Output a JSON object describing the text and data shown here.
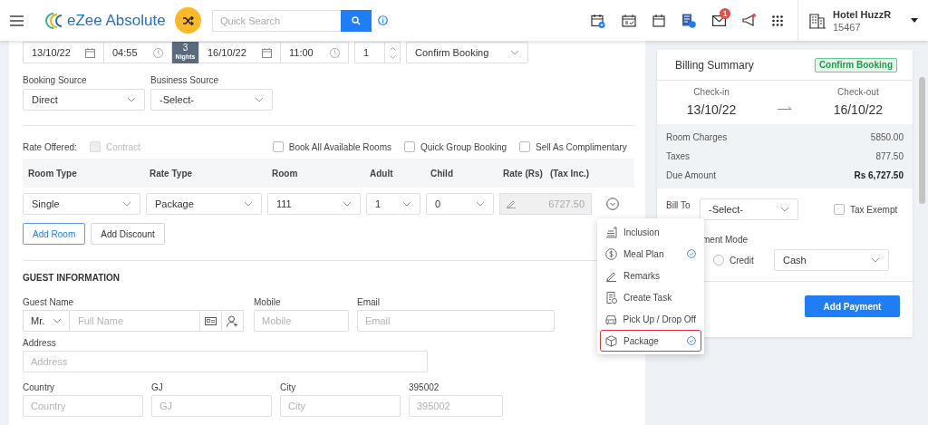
{
  "header": {
    "logo": "eZee Absolute",
    "search": {
      "placeholder": "Quick Search"
    },
    "mail_badge": "1",
    "hotel": {
      "name": "Hotel HuzzR",
      "code": "15467"
    }
  },
  "stay": {
    "arrival_date": "13/10/22",
    "arrival_time": "04:55",
    "nights": "3",
    "nights_label": "Nights",
    "departure_date": "16/10/22",
    "departure_time": "11:00",
    "rooms": "1",
    "status": "Confirm Booking"
  },
  "sources": [
    {
      "label": "Booking Source",
      "value": "Direct"
    },
    {
      "label": "Business Source",
      "value": "-Select-"
    }
  ],
  "rate_offered": {
    "label": "Rate Offered:",
    "options": [
      {
        "label": "Contract",
        "checked": false,
        "disabled": true
      },
      {
        "label": "Book All Available Rooms",
        "checked": false,
        "disabled": false
      },
      {
        "label": "Quick Group Booking",
        "checked": false,
        "disabled": false
      },
      {
        "label": "Sell As Complimentary",
        "checked": false,
        "disabled": false
      }
    ]
  },
  "table": {
    "columns": [
      "Room Type",
      "Rate Type",
      "Room",
      "Adult",
      "Child",
      "Rate (Rs)"
    ],
    "rate_note": "(Tax Inc.)",
    "rows": [
      {
        "room_type": "Single",
        "rate_type": "Package",
        "room": "111",
        "adult": "1",
        "child": "0",
        "rate": "6727.50"
      }
    ]
  },
  "buttons": [
    {
      "label": "Add Room",
      "kind": "primary"
    },
    {
      "label": "Add Discount",
      "kind": "default"
    }
  ],
  "guest": {
    "heading": "GUEST INFORMATION",
    "name": {
      "label": "Guest Name",
      "title": "Mr.",
      "placeholder": "Full Name"
    },
    "mobile": {
      "label": "Mobile",
      "placeholder": "Mobile"
    },
    "email": {
      "label": "Email",
      "placeholder": "Email"
    },
    "address": {
      "label": "Address",
      "placeholder": "Address"
    },
    "location": [
      {
        "label": "Country",
        "placeholder": "Country"
      },
      {
        "label": "GJ",
        "placeholder": "GJ"
      },
      {
        "label": "City",
        "placeholder": "City"
      },
      {
        "label": "395002",
        "placeholder": "395002"
      }
    ]
  },
  "row_menu": {
    "items": [
      {
        "label": "Inclusion",
        "checked": false,
        "selected": false
      },
      {
        "label": "Meal Plan",
        "checked": true,
        "selected": false
      },
      {
        "label": "Remarks",
        "checked": false,
        "selected": false
      },
      {
        "label": "Create Task",
        "checked": false,
        "selected": false
      },
      {
        "label": "Pick Up / Drop Off",
        "checked": false,
        "selected": false
      },
      {
        "label": "Package",
        "checked": true,
        "selected": true
      }
    ]
  },
  "billing": {
    "title": "Billing Summary",
    "status": "Confirm Booking",
    "check_in": {
      "label": "Check-in",
      "date": "13/10/22"
    },
    "check_out": {
      "label": "Check-out",
      "date": "16/10/22"
    },
    "charges": [
      {
        "label": "Room Charges",
        "amount": "5850.00",
        "emphasis": false
      },
      {
        "label": "Taxes",
        "amount": "877.50",
        "emphasis": false
      },
      {
        "label": "Due Amount",
        "amount": "Rs 6,727.50",
        "emphasis": true
      }
    ],
    "bill_to": {
      "label": "Bill To",
      "value": "-Select-"
    },
    "tax_exempt": {
      "label": "Tax Exempt",
      "checked": false
    },
    "payment_mode": {
      "label": "ment Mode",
      "options": [
        {
          "label": "Credit",
          "selected": false
        }
      ],
      "method": "Cash"
    },
    "add_payment": "Add Payment"
  }
}
